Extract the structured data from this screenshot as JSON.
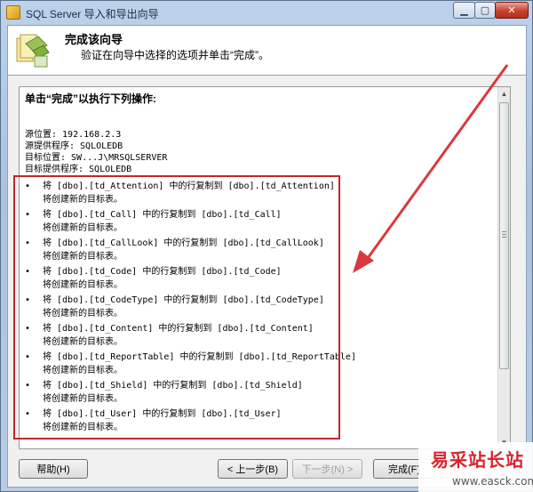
{
  "window": {
    "title": "SQL Server 导入和导出向导"
  },
  "header": {
    "title": "完成该向导",
    "subtitle": "验证在向导中选择的选项并单击“完成”。"
  },
  "panel": {
    "intro": "单击“完成”以执行下列操作:",
    "source_location": "源位置: 192.168.2.3",
    "source_provider": "源提供程序: SQLOLEDB",
    "dest_location": "目标位置: SW...J\\MRSQLSERVER",
    "dest_provider": "目标提供程序: SQLOLEDB",
    "operations": [
      {
        "line": "将 [dbo].[td_Attention] 中的行复制到 [dbo].[td_Attention]",
        "sub": "将创建新的目标表。"
      },
      {
        "line": "将 [dbo].[td_Call] 中的行复制到 [dbo].[td_Call]",
        "sub": "将创建新的目标表。"
      },
      {
        "line": "将 [dbo].[td_CallLook] 中的行复制到 [dbo].[td_CallLook]",
        "sub": "将创建新的目标表。"
      },
      {
        "line": "将 [dbo].[td_Code] 中的行复制到 [dbo].[td_Code]",
        "sub": "将创建新的目标表。"
      },
      {
        "line": "将 [dbo].[td_CodeType] 中的行复制到 [dbo].[td_CodeType]",
        "sub": "将创建新的目标表。"
      },
      {
        "line": "将 [dbo].[td_Content] 中的行复制到 [dbo].[td_Content]",
        "sub": "将创建新的目标表。"
      },
      {
        "line": "将 [dbo].[td_ReportTable] 中的行复制到 [dbo].[td_ReportTable]",
        "sub": "将创建新的目标表。"
      },
      {
        "line": "将 [dbo].[td_Shield] 中的行复制到 [dbo].[td_Shield]",
        "sub": "将创建新的目标表。"
      },
      {
        "line": "将 [dbo].[td_User] 中的行复制到 [dbo].[td_User]",
        "sub": "将创建新的目标表。"
      }
    ]
  },
  "footer": {
    "help": "帮助(H)",
    "back": "< 上一步(B)",
    "next": "下一步(N) >",
    "finish": "完成(F)",
    "cancel": ""
  },
  "watermark": {
    "text": "易采站长站",
    "url": "www.easck.com"
  },
  "colors": {
    "highlight": "#c0272d",
    "arrow": "#d9393e"
  },
  "icons": [
    "app-icon",
    "wizard-icon",
    "minimize-icon",
    "maximize-icon",
    "close-icon",
    "scroll-up-icon",
    "scroll-down-icon"
  ]
}
